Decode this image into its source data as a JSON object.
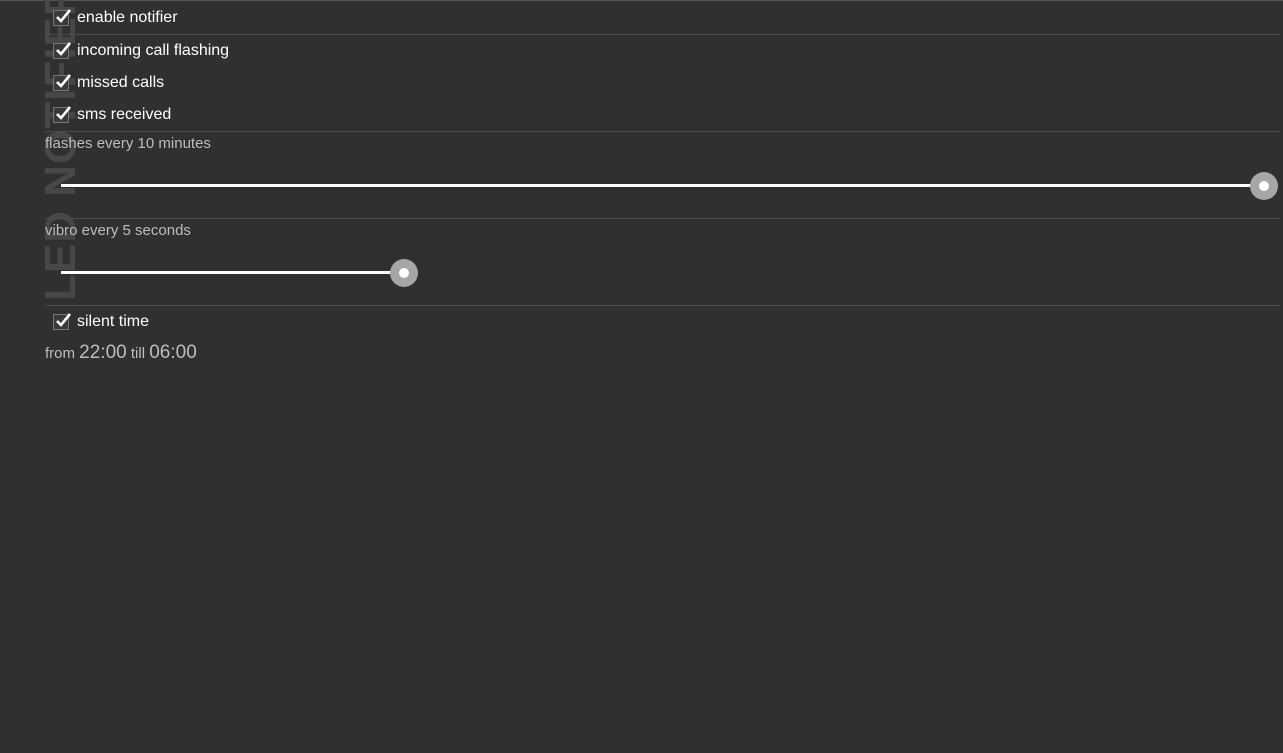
{
  "app_title": "LED NOTIFIER",
  "settings": {
    "enable_notifier": {
      "label": "enable notifier",
      "checked": true
    },
    "incoming_call_flashing": {
      "label": "incoming call flashing",
      "checked": true
    },
    "missed_calls": {
      "label": "missed calls",
      "checked": true
    },
    "sms_received": {
      "label": "sms received",
      "checked": true
    },
    "flash_interval": {
      "label": "flashes every 10 minutes",
      "fraction": 1.0
    },
    "vibro_interval": {
      "label": "vibro every 5 seconds",
      "fraction": 0.285
    },
    "silent_time": {
      "label": "silent time",
      "checked": true
    },
    "silent_range": {
      "from_label": "from",
      "from": "22:00",
      "till_label": "till",
      "till": "06:00"
    }
  },
  "colors": {
    "background": "#303030",
    "track": "#ffffff",
    "thumb": "#a6a6a6"
  }
}
